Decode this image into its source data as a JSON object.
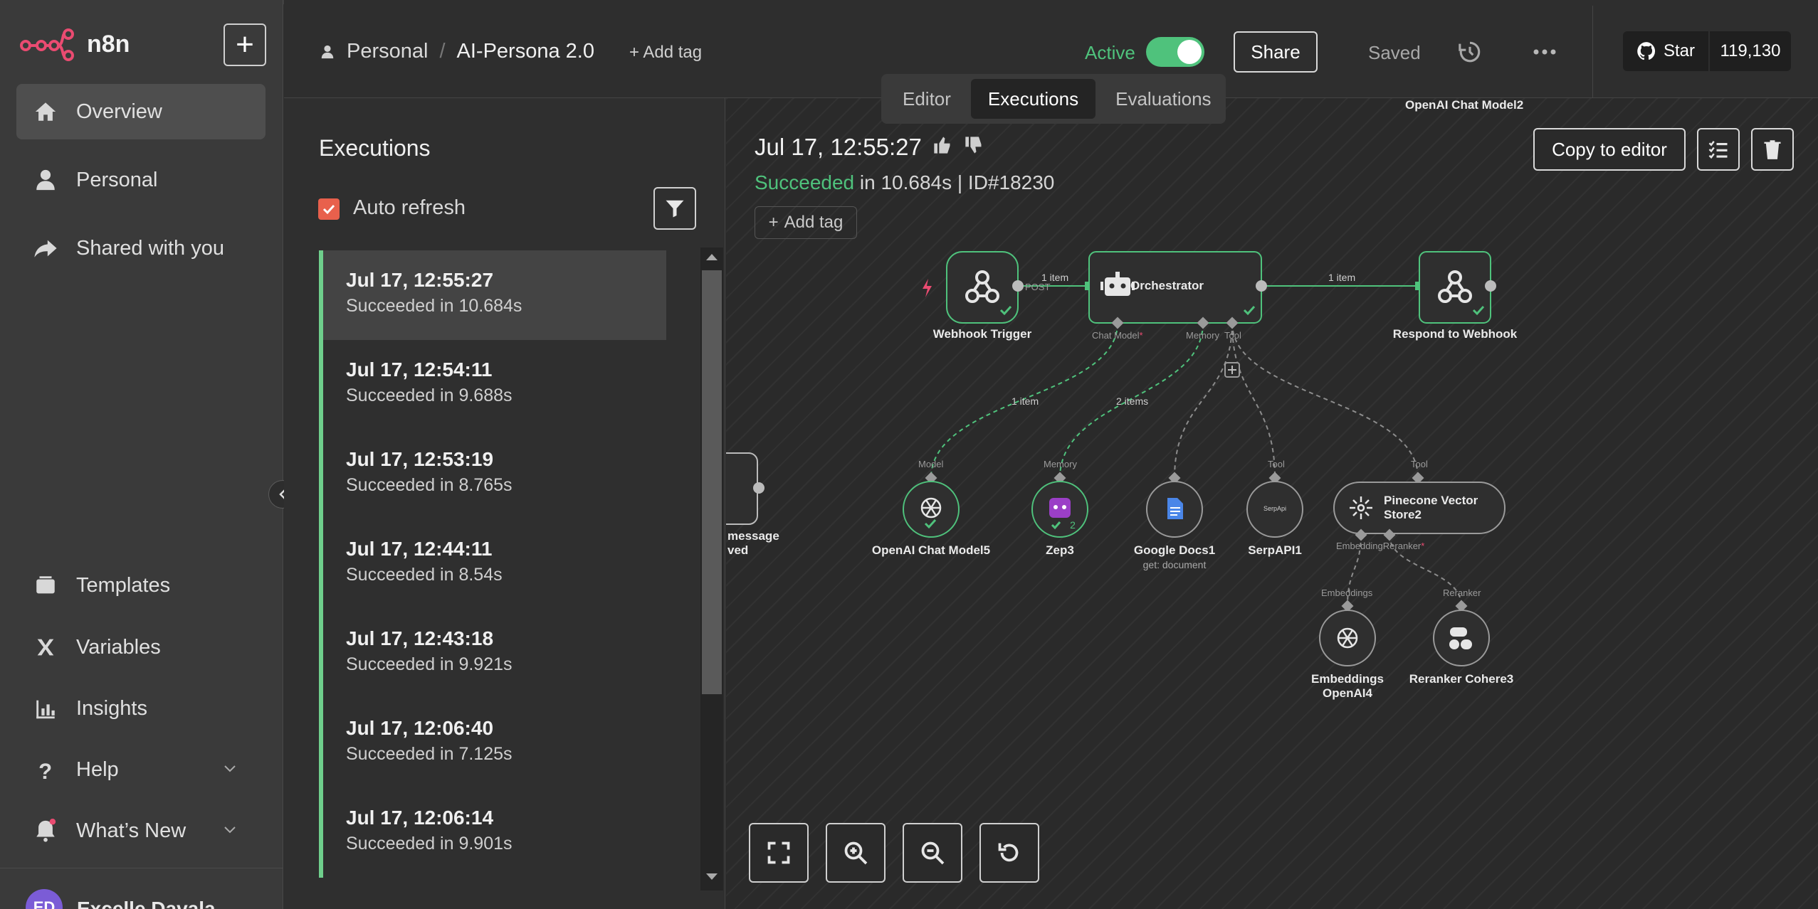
{
  "app": {
    "name": "n8n"
  },
  "sidebar": {
    "items": [
      {
        "label": "Overview",
        "icon": "home-icon",
        "active": true
      },
      {
        "label": "Personal",
        "icon": "user-icon"
      },
      {
        "label": "Shared with you",
        "icon": "share-icon"
      }
    ],
    "bottom_items": [
      {
        "label": "Templates",
        "icon": "templates-icon"
      },
      {
        "label": "Variables",
        "icon": "variables-icon"
      },
      {
        "label": "Insights",
        "icon": "insights-icon"
      },
      {
        "label": "Help",
        "icon": "help-icon"
      },
      {
        "label": "What’s New",
        "icon": "bell-icon"
      }
    ],
    "user": {
      "initials": "ED",
      "name": "Excelle Davala"
    }
  },
  "header": {
    "project": "Personal",
    "workflow": "AI-Persona 2.0",
    "add_tag": "+ Add tag",
    "active_label": "Active",
    "share_label": "Share",
    "saved_label": "Saved",
    "github_star": "Star",
    "github_count": "119,130"
  },
  "tabs": [
    {
      "label": "Editor"
    },
    {
      "label": "Executions",
      "selected": true
    },
    {
      "label": "Evaluations"
    }
  ],
  "executions": {
    "title": "Executions",
    "auto_refresh_label": "Auto refresh",
    "auto_refresh_checked": true,
    "items": [
      {
        "time": "Jul 17, 12:55:27",
        "status": "Succeeded in 10.684s"
      },
      {
        "time": "Jul 17, 12:54:11",
        "status": "Succeeded in 9.688s"
      },
      {
        "time": "Jul 17, 12:53:19",
        "status": "Succeeded in 8.765s"
      },
      {
        "time": "Jul 17, 12:44:11",
        "status": "Succeeded in 8.54s"
      },
      {
        "time": "Jul 17, 12:43:18",
        "status": "Succeeded in 9.921s"
      },
      {
        "time": "Jul 17, 12:06:40",
        "status": "Succeeded in 7.125s"
      },
      {
        "time": "Jul 17, 12:06:14",
        "status": "Succeeded in 9.901s"
      }
    ]
  },
  "run": {
    "date": "Jul 17, 12:55:27",
    "status_word": "Succeeded",
    "status_rest": " in 10.684s | ID#18230",
    "add_tag": "Add tag",
    "copy_to_editor": "Copy to editor"
  },
  "canvas": {
    "ghost_top_label": "OpenAI Chat Model2",
    "partial_node_label_1": "message",
    "partial_node_label_2": "ved",
    "nodes": {
      "webhook_trigger": "Webhook Trigger",
      "orchestrator": "Orchestrator",
      "respond": "Respond to Webhook",
      "openai_chat": "OpenAI Chat Model5",
      "zep": "Zep3",
      "zep_count": "2",
      "gdocs": "Google Docs1",
      "gdocs_sub": "get: document",
      "serpapi": "SerpAPI1",
      "serpapi_inner": "SerpApi",
      "pinecone": "Pinecone Vector Store2",
      "embeddings": "Embeddings OpenAI4",
      "reranker": "Reranker Cohere3"
    },
    "connectors": {
      "post": "POST",
      "chat_model": "Chat Model",
      "memory": "Memory",
      "tool": "Tool",
      "model": "Model",
      "memory2": "Memory",
      "tool2": "Tool",
      "tool3": "Tool",
      "embedding": "Embedding",
      "reranker": "Reranker",
      "embeddings": "Embeddings",
      "reranker2": "Reranker"
    },
    "edges": {
      "trigger_to_orch": "1 item",
      "orch_to_respond": "1 item",
      "model_edge": "1 item",
      "memory_edge": "2 items"
    }
  },
  "colors": {
    "accent": "#4fc27c",
    "brand": "#ea4b71",
    "checkbox": "#e8604c"
  }
}
